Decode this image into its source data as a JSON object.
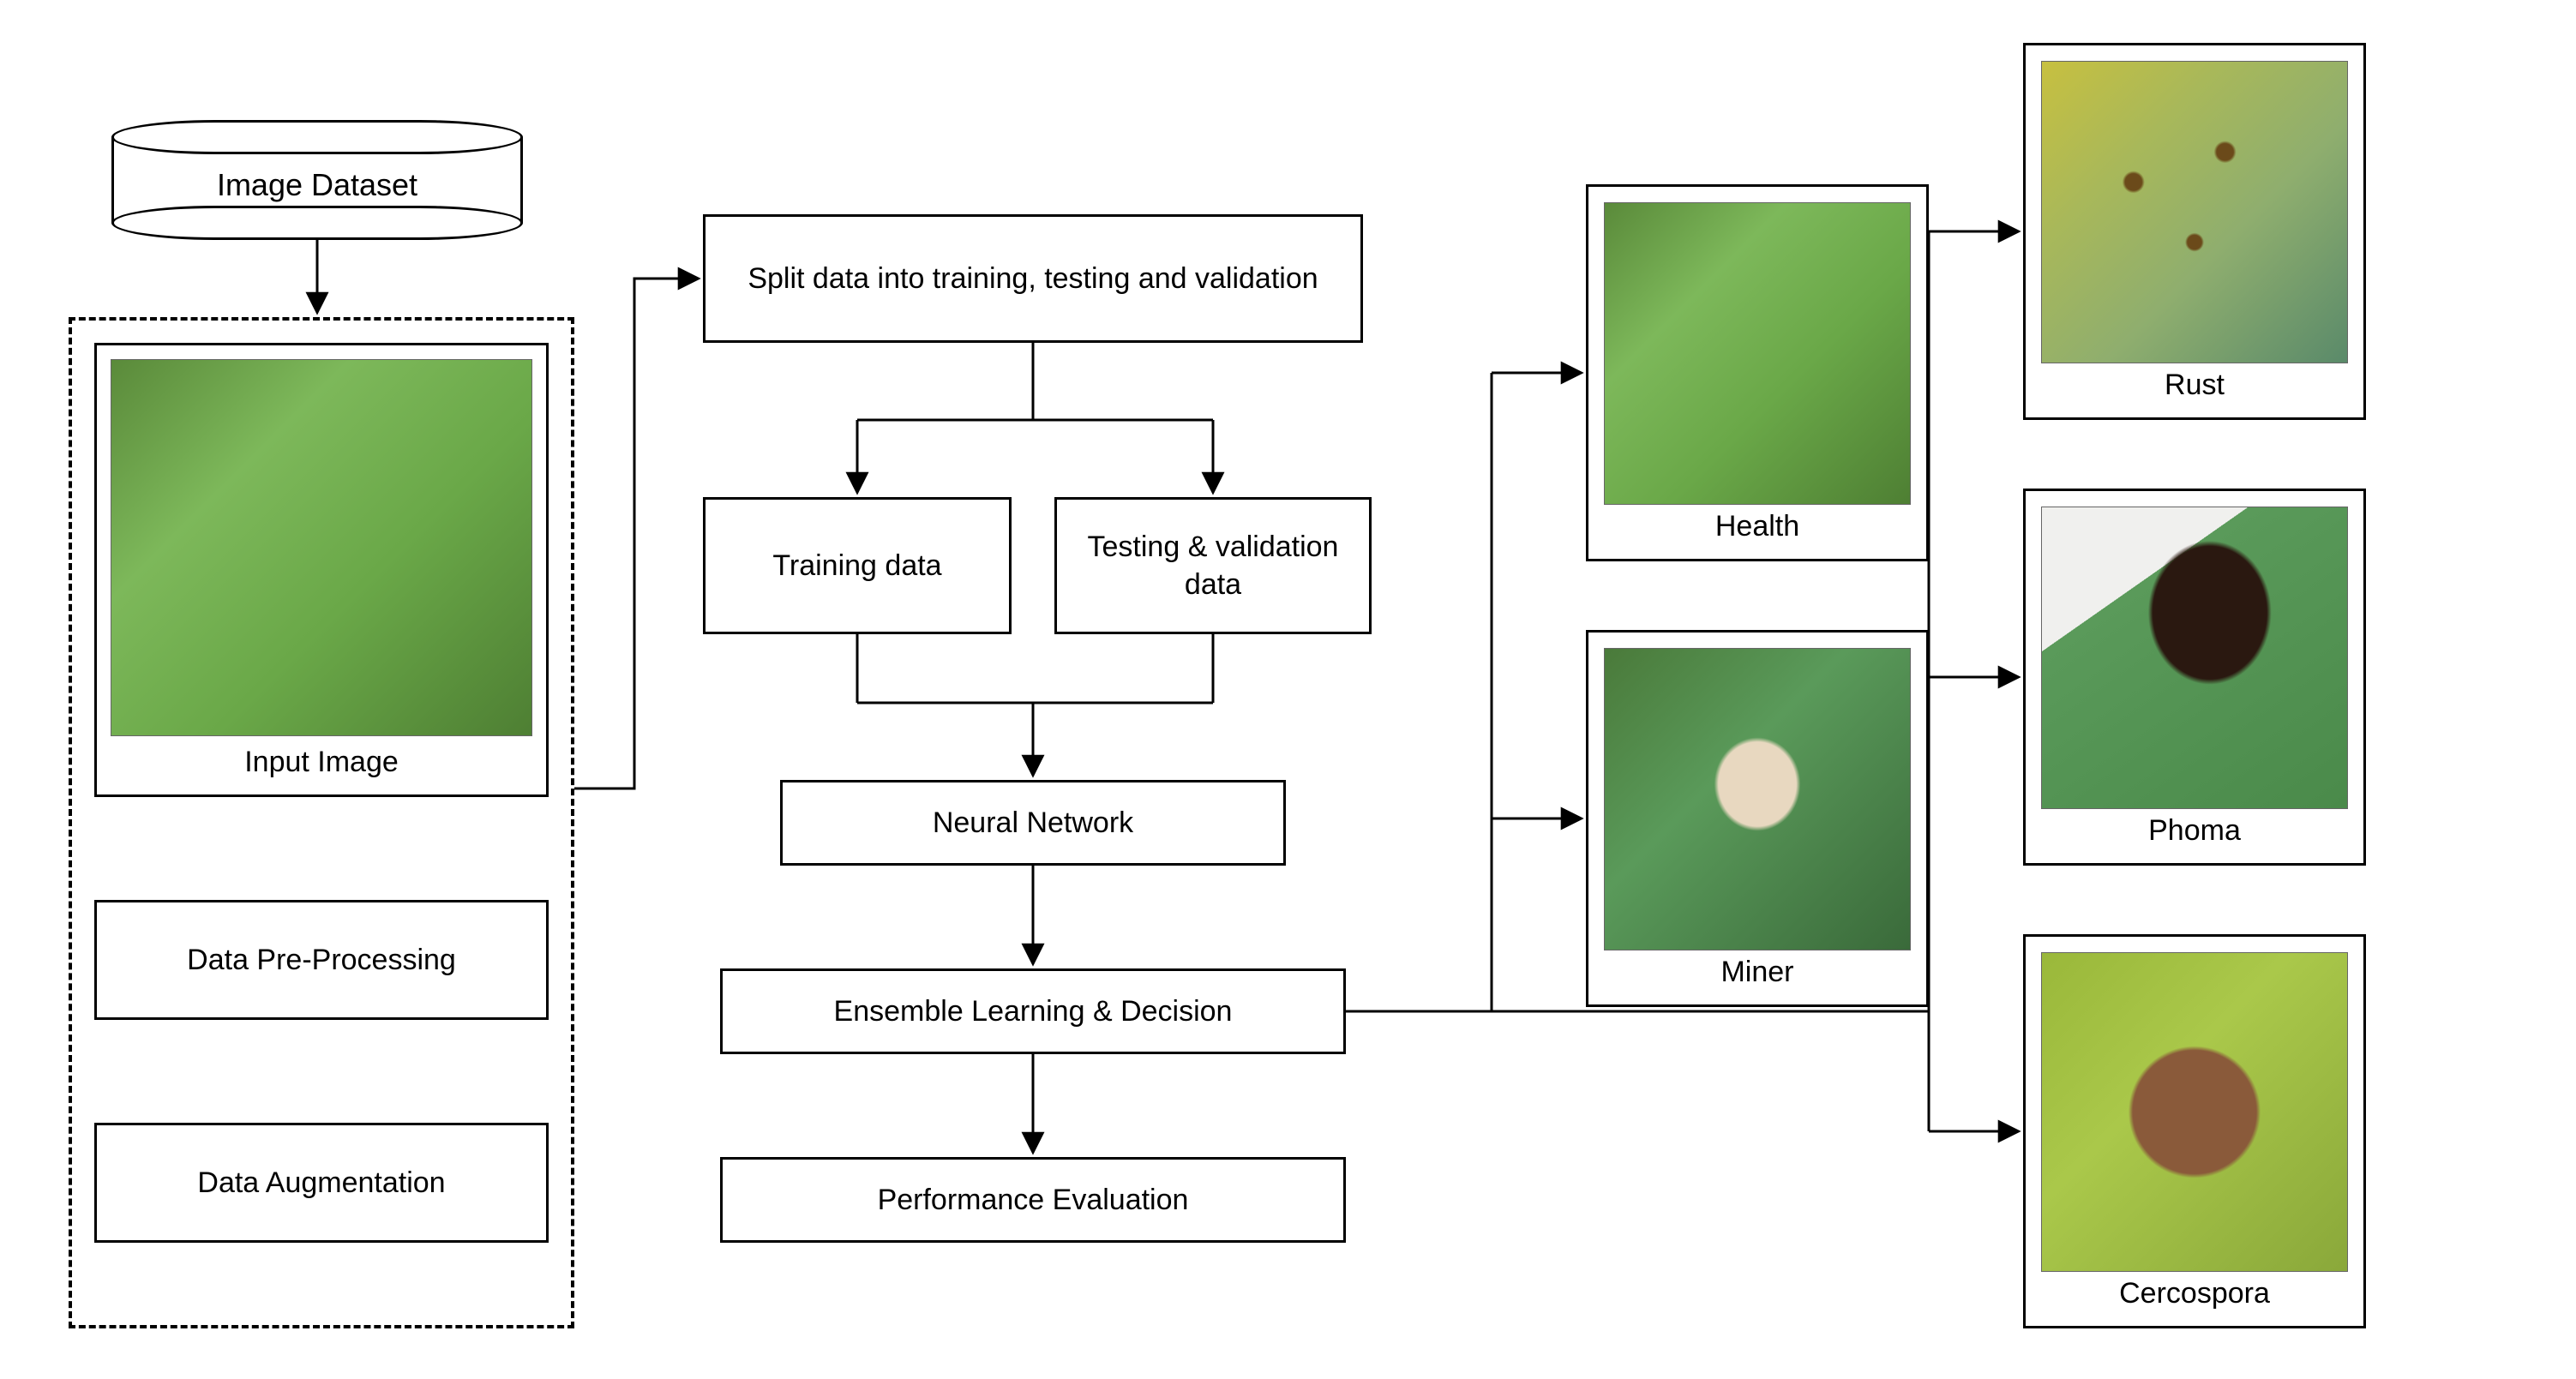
{
  "source": {
    "label": "Image Dataset"
  },
  "preproc_group": {
    "input_image_label": "Input Image",
    "preprocessing_label": "Data Pre-Processing",
    "augmentation_label": "Data Augmentation"
  },
  "pipeline": {
    "split_label": "Split data into training, testing and validation",
    "training_label": "Training data",
    "testval_label": "Testing & validation data",
    "nn_label": "Neural Network",
    "ensemble_label": "Ensemble Learning & Decision",
    "eval_label": "Performance Evaluation"
  },
  "outputs": {
    "health": "Health",
    "miner": "Miner",
    "rust": "Rust",
    "phoma": "Phoma",
    "cercospora": "Cercospora"
  }
}
